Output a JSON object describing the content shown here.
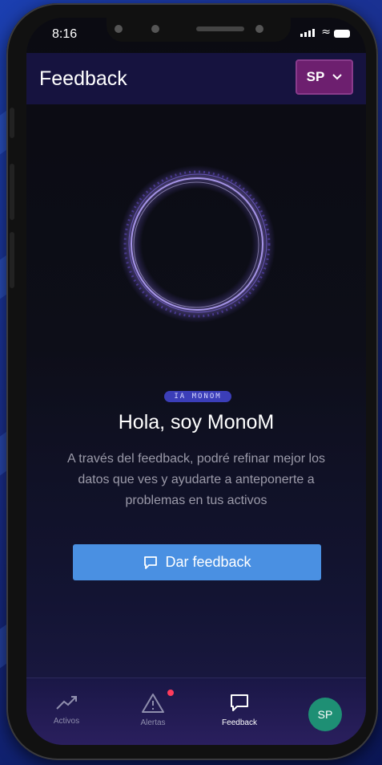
{
  "status_bar": {
    "time": "8:16"
  },
  "header": {
    "title": "Feedback",
    "user_initials": "SP"
  },
  "main": {
    "badge": "IA MONOM",
    "heading": "Hola, soy MonoM",
    "description": "A través del feedback, podré refinar mejor los datos que ves y ayudarte a anteponerte a problemas en tus activos",
    "feedback_button": "Dar feedback"
  },
  "tabbar": {
    "items": [
      {
        "label": "Activos",
        "icon": "trend-icon"
      },
      {
        "label": "Alertas",
        "icon": "warning-icon"
      },
      {
        "label": "Feedback",
        "icon": "chat-icon"
      }
    ],
    "avatar": "SP"
  },
  "colors": {
    "accent": "#4a90e2",
    "header_bg": "#16133f",
    "user_button": "#6d1f6f",
    "avatar": "#1e8f74",
    "notification_dot": "#ff3b5c",
    "badge": "#3b3eb8"
  }
}
